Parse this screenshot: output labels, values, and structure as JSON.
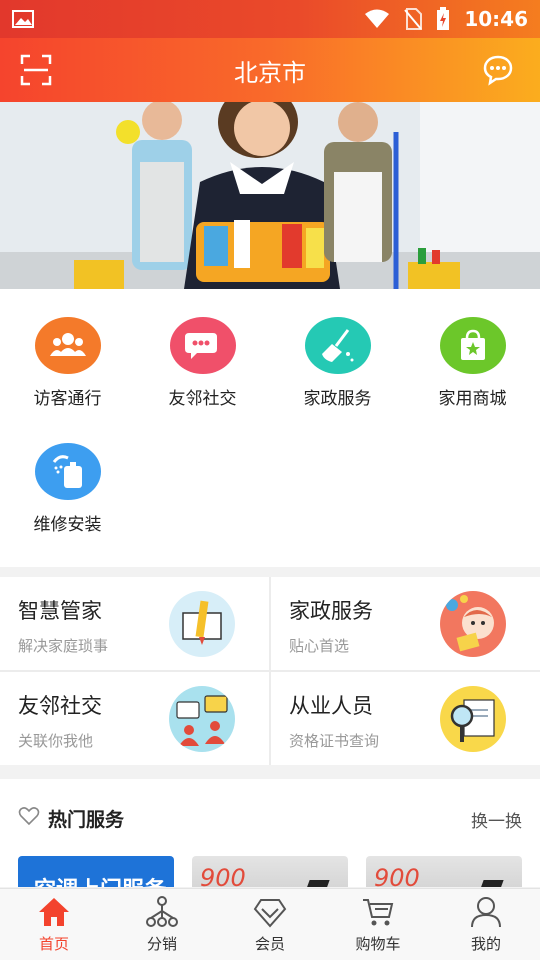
{
  "status_bar": {
    "time": "10:46"
  },
  "header": {
    "title": "北京市"
  },
  "services": [
    {
      "label": "访客通行",
      "color": "#f47a2a",
      "icon": "visitors-icon"
    },
    {
      "label": "友邻社交",
      "color": "#f0506a",
      "icon": "chat-bubbles-icon"
    },
    {
      "label": "家政服务",
      "color": "#25c9b4",
      "icon": "broom-icon"
    },
    {
      "label": "家用商城",
      "color": "#6cc72a",
      "icon": "shopping-bag-icon"
    },
    {
      "label": "维修安装",
      "color": "#3d9ef0",
      "icon": "shower-icon"
    }
  ],
  "cards": [
    {
      "title": "智慧管家",
      "subtitle": "解决家庭琐事",
      "icon": "pencil-book-icon"
    },
    {
      "title": "家政服务",
      "subtitle": "贴心首选",
      "icon": "baby-icon"
    },
    {
      "title": "友邻社交",
      "subtitle": "关联你我他",
      "icon": "people-chat-icon"
    },
    {
      "title": "从业人员",
      "subtitle": "资格证书查询",
      "icon": "magnifier-certificate-icon"
    }
  ],
  "hot": {
    "title": "热门服务",
    "swap": "换一换",
    "thumb1_text": "空调上门服务",
    "thumb2_text": "900",
    "thumb3_text": "900"
  },
  "tabs": [
    {
      "label": "首页",
      "active": true
    },
    {
      "label": "分销"
    },
    {
      "label": "会员"
    },
    {
      "label": "购物车"
    },
    {
      "label": "我的"
    }
  ],
  "colors": {
    "accent": "#f3432d",
    "header_start": "#f5442d",
    "header_end": "#fbad1e"
  }
}
